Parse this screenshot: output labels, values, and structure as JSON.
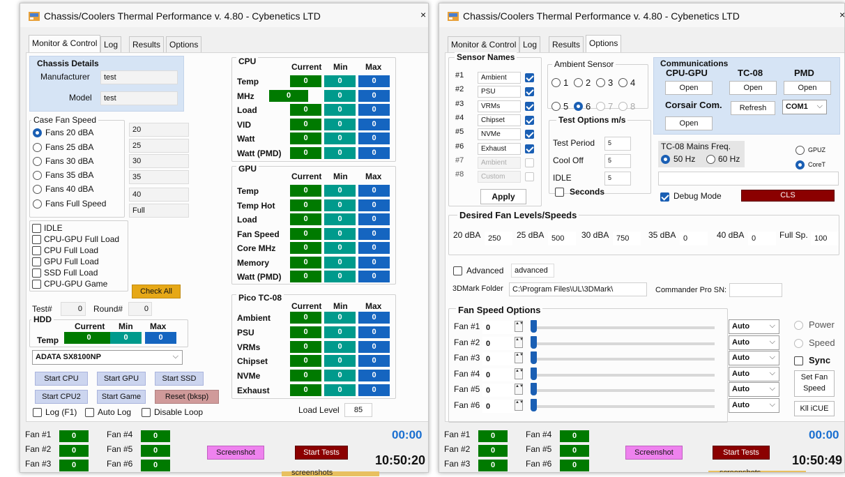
{
  "left_window": {
    "title": "Chassis/Coolers Thermal Performance v. 4.80 - Cybenetics LTD",
    "close": "×",
    "tabs": [
      "Monitor & Control",
      "Log",
      "Results",
      "Options"
    ],
    "chassis": {
      "title": "Chassis Details",
      "manufacturer_label": "Manufacturer",
      "manufacturer_value": "test",
      "model_label": "Model",
      "model_value": "test"
    },
    "case_fan": {
      "title": "Case Fan Speed",
      "options": [
        "Fans 20 dBA",
        "Fans 25 dBA",
        "Fans 30 dBA",
        "Fans 35 dBA",
        "Fans 40 dBA",
        "Fans Full Speed"
      ],
      "values": [
        "20",
        "25",
        "30",
        "35",
        "40",
        "Full"
      ]
    },
    "loads": [
      "IDLE",
      "CPU-GPU Full Load",
      "CPU Full Load",
      "GPU Full Load",
      "SSD Full Load",
      "CPU-GPU Game"
    ],
    "check_all": "Check All",
    "test_label": "Test#",
    "test_value": "0",
    "round_label": "Round#",
    "round_value": "0",
    "hdd": {
      "title": "HDD",
      "cols": [
        "Current",
        "Min",
        "Max"
      ],
      "row_label": "Temp",
      "values": [
        "0",
        "0",
        "0"
      ],
      "drive": "ADATA SX8100NP"
    },
    "buttons": {
      "start_cpu": "Start CPU",
      "start_gpu": "Start GPU",
      "start_ssd": "Start SSD",
      "start_cpu2": "Start CPU2",
      "start_game": "Start Game",
      "reset": "Reset (bksp)"
    },
    "log_f1": "Log (F1)",
    "auto_log": "Auto Log",
    "disable_loop": "Disable Loop",
    "load_level_label": "Load Level",
    "load_level_value": "85",
    "cpu": {
      "title": "CPU",
      "cols": [
        "Current",
        "Min",
        "Max"
      ],
      "rows": [
        {
          "label": "Temp",
          "v": [
            "0",
            "0",
            "0"
          ]
        },
        {
          "label": "MHz",
          "v": [
            "0",
            "0",
            "0"
          ]
        },
        {
          "label": "Load",
          "v": [
            "0",
            "0",
            "0"
          ]
        },
        {
          "label": "VID",
          "v": [
            "0",
            "0",
            "0"
          ]
        },
        {
          "label": "Watt",
          "v": [
            "0",
            "0",
            "0"
          ]
        },
        {
          "label": "Watt (PMD)",
          "v": [
            "0",
            "0",
            "0"
          ]
        }
      ]
    },
    "gpu": {
      "title": "GPU",
      "cols": [
        "Current",
        "Min",
        "Max"
      ],
      "rows": [
        {
          "label": "Temp",
          "v": [
            "0",
            "0",
            "0"
          ]
        },
        {
          "label": "Temp Hot",
          "v": [
            "0",
            "0",
            "0"
          ]
        },
        {
          "label": "Load",
          "v": [
            "0",
            "0",
            "0"
          ]
        },
        {
          "label": "Fan Speed",
          "v": [
            "0",
            "0",
            "0"
          ]
        },
        {
          "label": "Core MHz",
          "v": [
            "0",
            "0",
            "0"
          ]
        },
        {
          "label": "Memory",
          "v": [
            "0",
            "0",
            "0"
          ]
        },
        {
          "label": "Watt (PMD)",
          "v": [
            "0",
            "0",
            "0"
          ]
        }
      ]
    },
    "pico": {
      "title": "Pico TC-08",
      "cols": [
        "Current",
        "Min",
        "Max"
      ],
      "rows": [
        {
          "label": "Ambient",
          "v": [
            "0",
            "0",
            "0"
          ]
        },
        {
          "label": "PSU",
          "v": [
            "0",
            "0",
            "0"
          ]
        },
        {
          "label": "VRMs",
          "v": [
            "0",
            "0",
            "0"
          ]
        },
        {
          "label": "Chipset",
          "v": [
            "0",
            "0",
            "0"
          ]
        },
        {
          "label": "NVMe",
          "v": [
            "0",
            "0",
            "0"
          ]
        },
        {
          "label": "Exhaust",
          "v": [
            "0",
            "0",
            "0"
          ]
        }
      ]
    },
    "fans": [
      {
        "label": "Fan #1",
        "v": "0"
      },
      {
        "label": "Fan #2",
        "v": "0"
      },
      {
        "label": "Fan #3",
        "v": "0"
      },
      {
        "label": "Fan #4",
        "v": "0"
      },
      {
        "label": "Fan #5",
        "v": "0"
      },
      {
        "label": "Fan #6",
        "v": "0"
      }
    ],
    "screenshot": "Screenshot",
    "start_tests": "Start Tests",
    "timer": "00:00",
    "clock": "10:50:20"
  },
  "right_window": {
    "title": "Chassis/Coolers Thermal Performance v. 4.80 - Cybenetics LTD",
    "close": "×",
    "tabs": [
      "Monitor & Control",
      "Log",
      "Results",
      "Options"
    ],
    "sensor_names": {
      "title": "Sensor Names",
      "rows": [
        {
          "num": "#1",
          "name": "Ambient",
          "checked": true
        },
        {
          "num": "#2",
          "name": "PSU",
          "checked": true
        },
        {
          "num": "#3",
          "name": "VRMs",
          "checked": true
        },
        {
          "num": "#4",
          "name": "Chipset",
          "checked": true
        },
        {
          "num": "#5",
          "name": "NVMe",
          "checked": true
        },
        {
          "num": "#6",
          "name": "Exhaust",
          "checked": true
        },
        {
          "num": "#7",
          "name": "Ambient",
          "checked": false
        },
        {
          "num": "#8",
          "name": "Custom",
          "checked": false
        }
      ],
      "apply": "Apply"
    },
    "ambient_sensor": {
      "title": "Ambient Sensor",
      "options": [
        "1",
        "2",
        "3",
        "4",
        "5",
        "6",
        "7",
        "8"
      ],
      "selected": "6"
    },
    "test_options": {
      "title": "Test Options m/s",
      "rows": [
        {
          "label": "Test Period",
          "value": "5"
        },
        {
          "label": "Cool Off",
          "value": "5"
        },
        {
          "label": "IDLE",
          "value": "5"
        }
      ],
      "seconds": "Seconds"
    },
    "communications": {
      "title": "Communications",
      "cpu_gpu": "CPU-GPU",
      "tc08": "TC-08",
      "pmd": "PMD",
      "open": "Open",
      "corsair": "Corsair Com.",
      "refresh": "Refresh",
      "com_port": "COM1"
    },
    "mains": {
      "title": "TC-08 Mains Freq.",
      "hz50": "50 Hz",
      "hz60": "60 Hz"
    },
    "gpuz": "GPUZ",
    "coret": "CoreT",
    "debug_mode": "Debug Mode",
    "cls": "CLS",
    "desired": {
      "title": "Desired Fan Levels/Speeds",
      "items": [
        {
          "label": "20 dBA",
          "value": "250"
        },
        {
          "label": "25 dBA",
          "value": "500"
        },
        {
          "label": "30 dBA",
          "value": "750"
        },
        {
          "label": "35 dBA",
          "value": "0"
        },
        {
          "label": "40 dBA",
          "value": "0"
        },
        {
          "label": "Full Sp.",
          "value": "100"
        }
      ]
    },
    "advanced": "Advanced",
    "advanced_box": "advanced",
    "dmark_label": "3DMark Folder",
    "dmark_path": "C:\\Program Files\\UL\\3DMark\\",
    "commander_label": "Commander Pro SN:",
    "fan_speed": {
      "title": "Fan Speed Options",
      "fans": [
        {
          "label": "Fan #1",
          "value": "0",
          "mode": "Auto"
        },
        {
          "label": "Fan #2",
          "value": "0",
          "mode": "Auto"
        },
        {
          "label": "Fan #3",
          "value": "0",
          "mode": "Auto"
        },
        {
          "label": "Fan #4",
          "value": "0",
          "mode": "Auto"
        },
        {
          "label": "Fan #5",
          "value": "0",
          "mode": "Auto"
        },
        {
          "label": "Fan #6",
          "value": "0",
          "mode": "Auto"
        }
      ]
    },
    "power": "Power",
    "speed": "Speed",
    "sync": "Sync",
    "set_fan_speed": "Set Fan Speed",
    "kill_icue": "Kll iCUE",
    "fans": [
      {
        "label": "Fan #1",
        "v": "0"
      },
      {
        "label": "Fan #2",
        "v": "0"
      },
      {
        "label": "Fan #3",
        "v": "0"
      },
      {
        "label": "Fan #4",
        "v": "0"
      },
      {
        "label": "Fan #5",
        "v": "0"
      },
      {
        "label": "Fan #6",
        "v": "0"
      }
    ],
    "screenshot": "Screenshot",
    "start_tests": "Start Tests",
    "timer": "00:00",
    "clock": "10:50:49",
    "footer_folder": "screenshots"
  },
  "colors": {
    "green": "#007a00",
    "teal": "#009a8c",
    "blue": "#1565c0",
    "accent": "#1a5fb4",
    "dark_red": "#8b0000",
    "pink": "#ee82ee",
    "orange": "#e6a817",
    "timer": "#1a6fd0"
  }
}
